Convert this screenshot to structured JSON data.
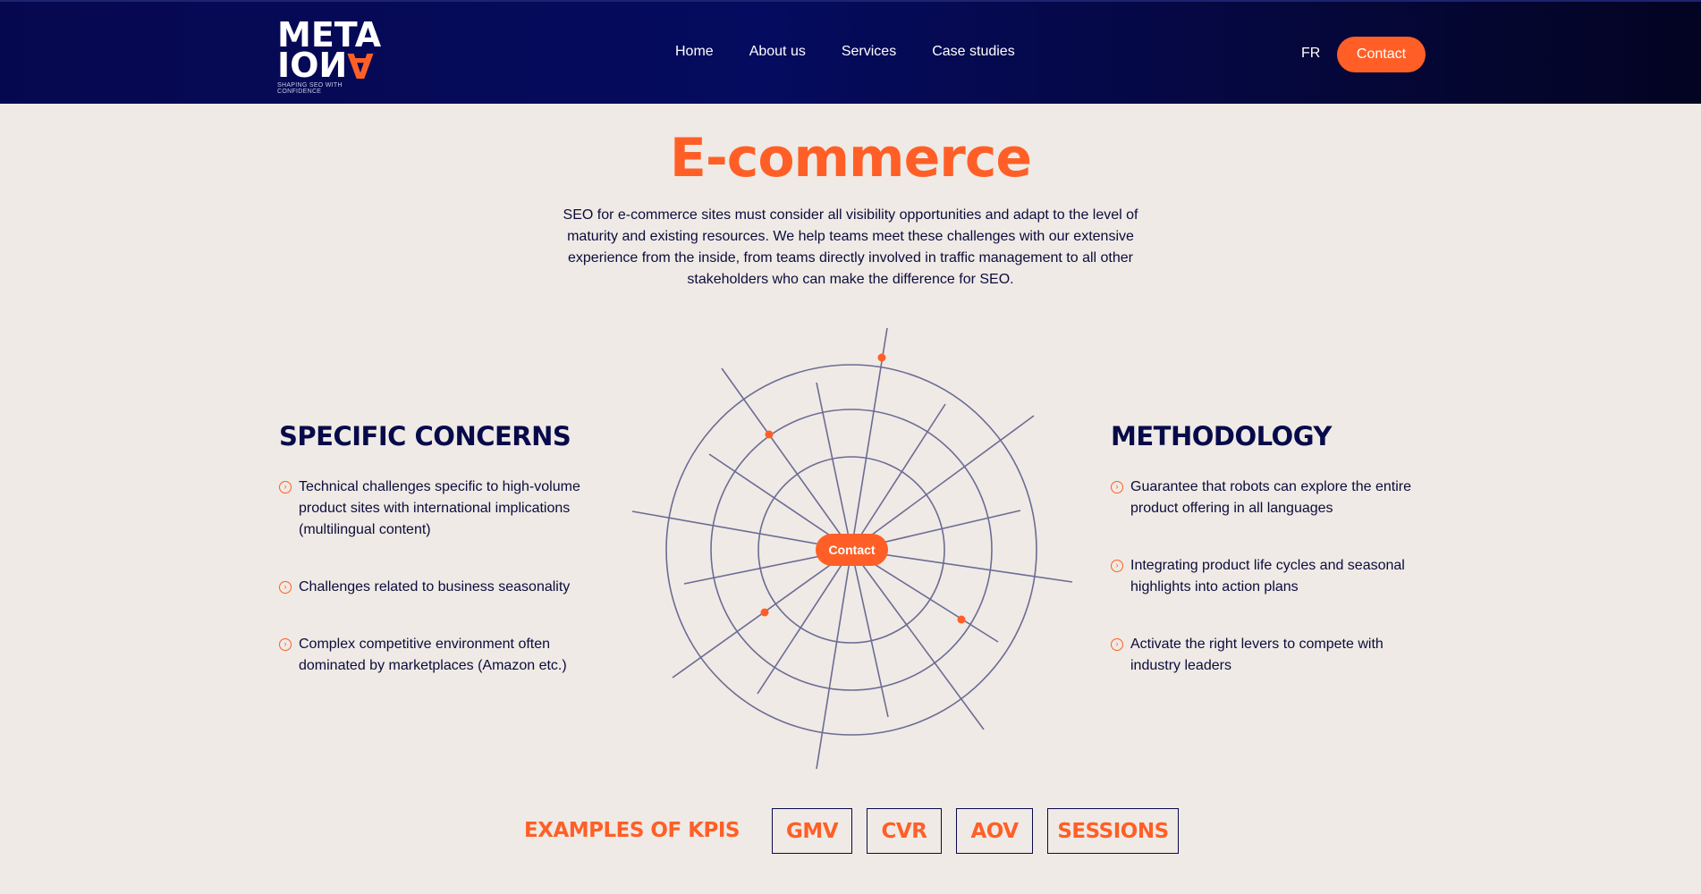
{
  "header": {
    "logo_line1": "META",
    "logo_line2a": "NOI",
    "logo_line2b": "A",
    "logo_tagline": "SHAPING SEO WITH CONFIDENCE",
    "nav": [
      "Home",
      "About us",
      "Services",
      "Case studies"
    ],
    "lang": "FR",
    "cta": "Contact"
  },
  "main": {
    "title": "E-commerce",
    "intro": "SEO for e-commerce sites must consider all visibility opportunities and adapt to the level of maturity and existing resources. We help teams meet these challenges with our extensive experience from the inside, from teams directly involved in traffic management to all other stakeholders who can make the difference for SEO.",
    "concerns": {
      "title": "SPECIFIC CONCERNS",
      "items": [
        "Technical challenges specific to high-volume product sites with international implications (multilingual content)",
        "Challenges related to business seasonality",
        "Complex competitive environment often dominated by marketplaces (Amazon etc.)"
      ]
    },
    "methodology": {
      "title": "METHODOLOGY",
      "items": [
        "Guarantee that robots can explore the entire product offering in all languages",
        "Integrating product life cycles and seasonal highlights into action plans",
        "Activate the right levers to compete with industry leaders"
      ]
    },
    "radar_cta": "Contact",
    "kpis": {
      "label": "EXAMPLES OF KPIS",
      "items": [
        "GMV",
        "CVR",
        "AOV",
        "SESSIONS"
      ]
    }
  },
  "colors": {
    "accent": "#ff5f27",
    "navy": "#070a4a",
    "background": "#efeae5"
  }
}
